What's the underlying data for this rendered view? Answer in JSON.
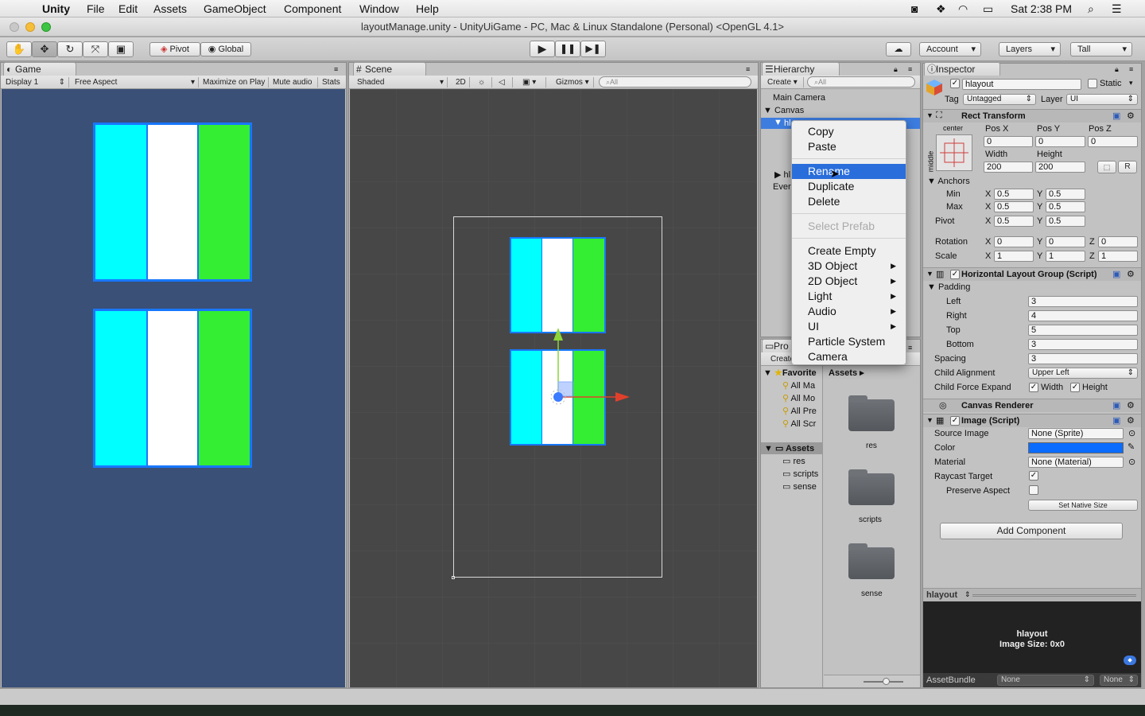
{
  "menubar": {
    "items": [
      "Unity",
      "File",
      "Edit",
      "Assets",
      "GameObject",
      "Component",
      "Window",
      "Help"
    ],
    "clock": "Sat 2:38 PM"
  },
  "window": {
    "title": "layoutManage.unity - UnityUiGame - PC, Mac & Linux Standalone (Personal) <OpenGL 4.1>"
  },
  "toolbar": {
    "pivot": "Pivot",
    "global": "Global",
    "account": "Account",
    "layers": "Layers",
    "layout": "Tall"
  },
  "game": {
    "tab": "Game",
    "display": "Display 1",
    "aspect": "Free Aspect",
    "maximize": "Maximize on Play",
    "mute": "Mute audio",
    "stats": "Stats"
  },
  "scene": {
    "tab": "Scene",
    "shading": "Shaded",
    "mode2d": "2D",
    "gizmos": "Gizmos",
    "search_placeholder": "All"
  },
  "hierarchy": {
    "tab": "Hierarchy",
    "create": "Create",
    "search_placeholder": "All",
    "items": [
      "Main Camera",
      "Canvas",
      "hl",
      "hl",
      "Ever"
    ]
  },
  "context_menu": {
    "copy": "Copy",
    "paste": "Paste",
    "rename": "Rename",
    "duplicate": "Duplicate",
    "delete": "Delete",
    "select_prefab": "Select Prefab",
    "create_empty": "Create Empty",
    "obj3d": "3D Object",
    "obj2d": "2D Object",
    "light": "Light",
    "audio": "Audio",
    "ui": "UI",
    "particle": "Particle System",
    "camera": "Camera"
  },
  "project": {
    "tab": "Pro",
    "create": "Create",
    "favorites": "Favorite",
    "fav_items": [
      "All Ma",
      "All Mo",
      "All Pre",
      "All Scr"
    ],
    "assets_root": "Assets",
    "asset_folders": [
      "res",
      "scripts",
      "sense"
    ],
    "breadcrumb": "Assets",
    "grid_folders": [
      "res",
      "scripts",
      "sense"
    ]
  },
  "inspector": {
    "tab": "Inspector",
    "name": "hlayout",
    "static": "Static",
    "tag_label": "Tag",
    "tag": "Untagged",
    "layer_label": "Layer",
    "layer": "UI",
    "rect": {
      "title": "Rect Transform",
      "anchor_h": "center",
      "anchor_v": "middle",
      "posx_label": "Pos X",
      "posy_label": "Pos Y",
      "posz_label": "Pos Z",
      "posx": "0",
      "posy": "0",
      "posz": "0",
      "width_label": "Width",
      "height_label": "Height",
      "width": "200",
      "height": "200",
      "r_btn": "R",
      "anchors": "Anchors",
      "min": "Min",
      "max": "Max",
      "pivot": "Pivot",
      "x": "X",
      "y": "Y",
      "z": "Z",
      "min_x": "0.5",
      "min_y": "0.5",
      "max_x": "0.5",
      "max_y": "0.5",
      "pivot_x": "0.5",
      "pivot_y": "0.5",
      "rotation": "Rotation",
      "scale": "Scale",
      "rot_x": "0",
      "rot_y": "0",
      "rot_z": "0",
      "scale_x": "1",
      "scale_y": "1",
      "scale_z": "1"
    },
    "hlg": {
      "title": "Horizontal Layout Group (Script)",
      "padding": "Padding",
      "left_label": "Left",
      "left": "3",
      "right_label": "Right",
      "right": "4",
      "top_label": "Top",
      "top": "5",
      "bottom_label": "Bottom",
      "bottom": "3",
      "spacing_label": "Spacing",
      "spacing": "3",
      "align_label": "Child Alignment",
      "align": "Upper Left",
      "expand_label": "Child Force Expand",
      "expand_w": "Width",
      "expand_h": "Height"
    },
    "canvas_renderer": "Canvas Renderer",
    "image": {
      "title": "Image (Script)",
      "source_label": "Source Image",
      "source": "None (Sprite)",
      "color_label": "Color",
      "color": "#0a6cff",
      "material_label": "Material",
      "material": "None (Material)",
      "raycast_label": "Raycast Target",
      "preserve_label": "Preserve Aspect",
      "native": "Set Native Size"
    },
    "add_component": "Add Component",
    "preview": {
      "header": "hlayout",
      "name": "hlayout",
      "size": "Image Size: 0x0"
    },
    "assetbundle_label": "AssetBundle",
    "assetbundle": "None",
    "assetbundle_variant": "None"
  },
  "colors": {
    "cyan": "#00ffff",
    "green": "#33ee33",
    "border_blue": "#1877ff",
    "game_bg": "#3a5077",
    "scene_bg": "#474747",
    "highlight": "#2a6edb"
  }
}
